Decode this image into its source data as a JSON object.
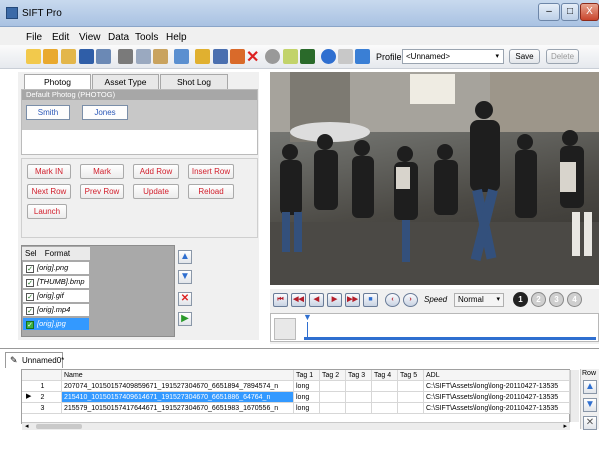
{
  "window": {
    "title": "SIFT Pro",
    "minimize": "–",
    "maximize": "□",
    "close": "X"
  },
  "menu": [
    "File",
    "Edit",
    "View",
    "Data",
    "Tools",
    "Help"
  ],
  "toolbar": {
    "profile_label": "Profile",
    "profile_value": "<Unnamed>",
    "save_label": "Save",
    "delete_label": "Delete"
  },
  "tabs": [
    {
      "label": "Photog"
    },
    {
      "label": "Asset Type"
    },
    {
      "label": "Shot Log"
    }
  ],
  "photog": {
    "header": "Default   Photog (PHOTOG)",
    "buttons": [
      "Smith",
      "Jones"
    ]
  },
  "actions": [
    [
      "Mark IN",
      "Mark",
      "Add Row",
      "Insert Row"
    ],
    [
      "Next Row",
      "Prev Row",
      "Update",
      "Reload"
    ],
    [
      "Launch"
    ]
  ],
  "formats": {
    "header_sel": "Sel",
    "header_format": "Format",
    "items": [
      {
        "label": "[orig].png",
        "checked": true
      },
      {
        "label": "[THUMB].bmp",
        "checked": true
      },
      {
        "label": "[orig].gif",
        "checked": true
      },
      {
        "label": "[orig].mp4",
        "checked": true
      },
      {
        "label": "[orig].jpg",
        "checked": true,
        "selected": true
      }
    ]
  },
  "player": {
    "speed_label": "Speed",
    "speed_value": "Normal",
    "markers": [
      "1",
      "2",
      "3",
      "4"
    ]
  },
  "document": {
    "tab_label": "Unnamed0*"
  },
  "table": {
    "columns": [
      "Name",
      "Tag 1",
      "Tag 2",
      "Tag 3",
      "Tag 4",
      "Tag 5",
      "ADL",
      "Row"
    ],
    "rows": [
      {
        "num": "1",
        "name": "207074_10150157409859671_191527304670_6651894_7894574_n",
        "tag1": "long",
        "adl": "C:\\SIFT\\Assets\\long\\long-20110427-13535"
      },
      {
        "num": "2",
        "name": "215410_10150157409614671_191527304670_6651886_64764_n",
        "tag1": "long",
        "adl": "C:\\SIFT\\Assets\\long\\long-20110427-13535"
      },
      {
        "num": "3",
        "name": "215579_10150157417644671_191527304670_6651983_1670556_n",
        "tag1": "long",
        "adl": "C:\\SIFT\\Assets\\long\\long-20110427-13535"
      }
    ]
  },
  "colors": {
    "selection": "#3399ff",
    "action_text": "#d11d2a",
    "photog_link": "#2b58b8"
  }
}
